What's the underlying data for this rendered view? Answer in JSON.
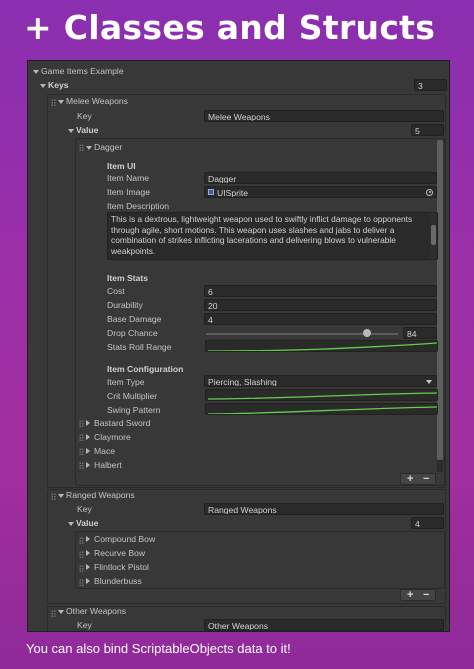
{
  "headline": "+ Classes and Structs",
  "footer": "You can also bind ScriptableObjects data to it!",
  "inspector": {
    "root_label": "Game Items Example",
    "keys_label": "Keys",
    "keys_count": "3",
    "melee": {
      "header": "Melee Weapons",
      "key_label": "Key",
      "key_value": "Melee Weapons",
      "value_label": "Value",
      "value_count": "5",
      "expanded_item": "Dagger",
      "item_ui": {
        "header": "Item UI",
        "name_label": "Item Name",
        "name_value": "Dagger",
        "image_label": "Item Image",
        "image_value": "UISprite",
        "desc_label": "Item Description",
        "desc_value": "This is a dextrous, lightweight weapon used to swiftly inflict damage to opponents through agile, short motions. This weapon uses slashes and jabs to deliver a combination of strikes inflicting lacerations and delivering blows to vulnerable weakpoints."
      },
      "item_stats": {
        "header": "Item Stats",
        "cost_label": "Cost",
        "cost_value": "6",
        "durability_label": "Durability",
        "durability_value": "20",
        "base_damage_label": "Base Damage",
        "base_damage_value": "4",
        "drop_chance_label": "Drop Chance",
        "drop_chance_value": "84",
        "drop_chance_fraction": 0.84,
        "roll_range_label": "Stats Roll Range"
      },
      "item_config": {
        "header": "Item Configuration",
        "type_label": "Item Type",
        "type_value": "Piercing, Slashing",
        "crit_label": "Crit Multiplier",
        "swing_label": "Swing Pattern"
      },
      "collapsed_items": [
        "Bastard Sword",
        "Claymore",
        "Mace",
        "Halbert"
      ]
    },
    "ranged": {
      "header": "Ranged Weapons",
      "key_label": "Key",
      "key_value": "Ranged Weapons",
      "value_label": "Value",
      "value_count": "4",
      "items": [
        "Compound Bow",
        "Recurve Bow",
        "Flintlock Pistol",
        "Blunderbuss"
      ]
    },
    "other": {
      "header": "Other Weapons",
      "key_label": "Key",
      "key_value": "Other Weapons"
    },
    "plus": "+",
    "minus": "−"
  },
  "colors": {
    "curve_green": "#5ed14a",
    "background_top": "#8a2fb0",
    "panel": "#383838"
  },
  "icons": [
    "fold-arrow-icon",
    "object-field-icon",
    "target-picker-icon",
    "dropdown-arrow-icon",
    "drag-handle-icon"
  ]
}
